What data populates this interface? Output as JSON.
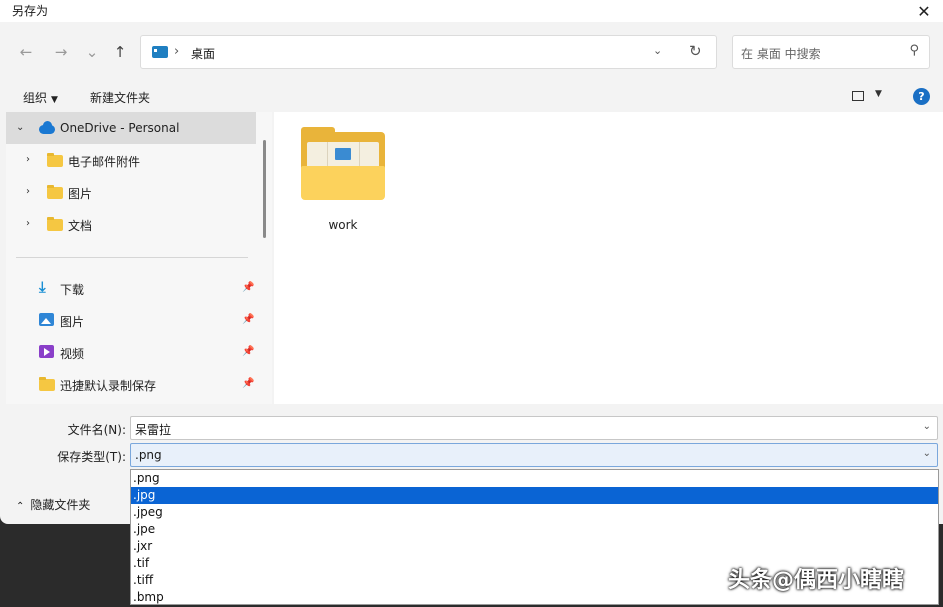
{
  "window": {
    "title": "另存为"
  },
  "nav": {
    "back": "←",
    "forward": "→",
    "recent": "⌄",
    "up": "↑",
    "address_current": "桌面",
    "search_placeholder": "在 桌面 中搜索"
  },
  "toolbar": {
    "organize_label": "组织",
    "new_folder_label": "新建文件夹"
  },
  "sidebar": {
    "onedrive": "OneDrive - Personal",
    "onedrive_items": [
      "电子邮件附件",
      "图片",
      "文档"
    ],
    "quick_access": [
      "下载",
      "图片",
      "视频",
      "迅捷默认录制保存"
    ]
  },
  "content": {
    "folders": [
      {
        "name": "work"
      }
    ]
  },
  "form": {
    "filename_label": "文件名(N):",
    "filename_value": "呆雷拉",
    "filetype_label": "保存类型(T):",
    "filetype_value": ".png"
  },
  "footer": {
    "hide_folders_label": "隐藏文件夹"
  },
  "dropdown": {
    "options": [
      ".png",
      ".jpg",
      ".jpeg",
      ".jpe",
      ".jxr",
      ".tif",
      ".tiff",
      ".bmp"
    ],
    "highlighted": ".jpg"
  },
  "watermark": {
    "text": "头条@偶西小瞎瞎"
  },
  "colors": {
    "accent": "#0a64d4",
    "folder": "#f5c742",
    "onedrive": "#1a78d2"
  }
}
